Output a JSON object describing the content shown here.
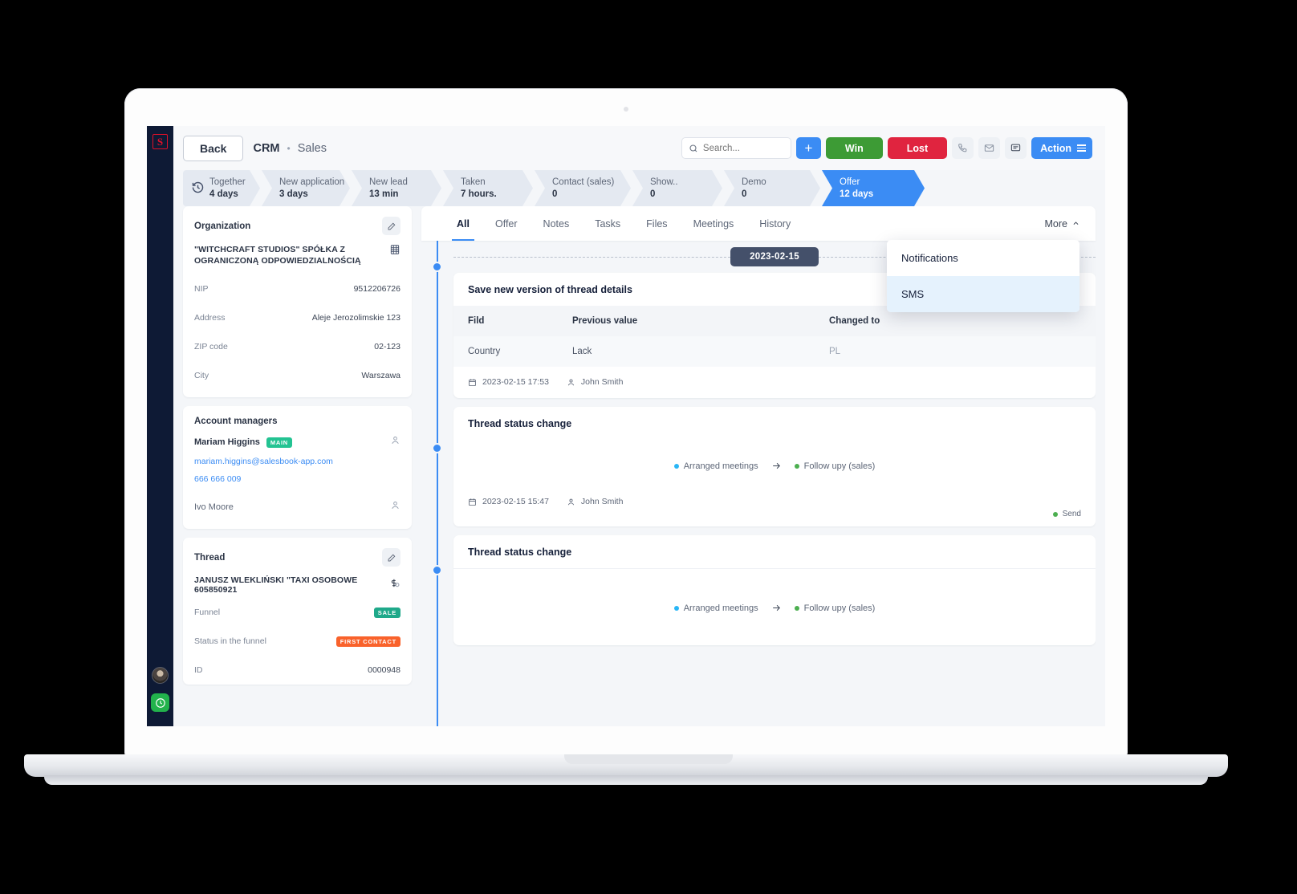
{
  "rail": {
    "logo_text": "S",
    "logo_name": "salesbook-logo",
    "avatar_name": "user-avatar",
    "clock_name": "time-tracker-icon"
  },
  "topbar": {
    "back_label": "Back",
    "breadcrumb_app": "CRM",
    "breadcrumb_sep": "•",
    "breadcrumb_section": "Sales",
    "search_placeholder": "Search...",
    "search_value": "",
    "add_label": "+",
    "win_label": "Win",
    "lost_label": "Lost",
    "action_label": "Action",
    "colors": {
      "win": "#3d9b35",
      "lost": "#e0243f",
      "primary": "#3b8cf4"
    }
  },
  "funnel": {
    "stages": [
      {
        "name": "Together",
        "value": "4 days",
        "icon": "history-icon",
        "active": false
      },
      {
        "name": "New application",
        "value": "3 days",
        "active": false
      },
      {
        "name": "New lead",
        "value": "13 min",
        "active": false
      },
      {
        "name": "Taken",
        "value": "7 hours.",
        "active": false
      },
      {
        "name": "Contact (sales)",
        "value": "0",
        "active": false
      },
      {
        "name": "Show..",
        "value": "0",
        "active": false
      },
      {
        "name": "Demo",
        "value": "0",
        "active": false
      },
      {
        "name": "Offer",
        "value": "12 days",
        "active": true
      }
    ]
  },
  "organization": {
    "card_title": "Organization",
    "name": "\"WITCHCRAFT STUDIOS\" SPÓŁKA Z OGRANICZONĄ ODPOWIEDZIALNOŚCIĄ",
    "fields": [
      {
        "label": "NIP",
        "value": "9512206726"
      },
      {
        "label": "Address",
        "value": "Aleje Jerozolimskie 123"
      },
      {
        "label": "ZIP code",
        "value": "02-123"
      },
      {
        "label": "City",
        "value": "Warszawa"
      }
    ]
  },
  "account_managers": {
    "card_title": "Account managers",
    "main": {
      "name": "Mariam Higgins",
      "badge": "MAIN",
      "email": "mariam.higgins@salesbook-app.com",
      "phone": "666 666 009"
    },
    "secondary": {
      "name": "Ivo Moore"
    }
  },
  "thread": {
    "card_title": "Thread",
    "name": "JANUSZ WLEKLIŃSKI \"TAXI OSOBOWE 605850921",
    "rows": [
      {
        "label": "Funnel",
        "badge": "SALE",
        "badge_color": "#1fa98a"
      },
      {
        "label": "Status in the funnel",
        "badge": "FIRST CONTACT",
        "badge_color": "#f9622b"
      },
      {
        "label": "ID",
        "value": "0000948"
      }
    ]
  },
  "tabs": {
    "items": [
      {
        "label": "All",
        "active": true
      },
      {
        "label": "Offer",
        "active": false
      },
      {
        "label": "Notes",
        "active": false
      },
      {
        "label": "Tasks",
        "active": false
      },
      {
        "label": "Files",
        "active": false
      },
      {
        "label": "Meetings",
        "active": false
      },
      {
        "label": "History",
        "active": false
      }
    ],
    "more_label": "More"
  },
  "dropdown": {
    "items": [
      {
        "label": "Notifications",
        "highlighted": false
      },
      {
        "label": "SMS",
        "highlighted": true
      }
    ]
  },
  "feed": {
    "date_separator": "2023-02-15",
    "entries": [
      {
        "title": "Save new version of thread details",
        "table": {
          "headers": [
            "Fild",
            "Previous value",
            "Changed to"
          ],
          "rows": [
            [
              "Country",
              "Lack",
              "PL"
            ]
          ]
        },
        "timestamp": "2023-02-15 17:53",
        "author": "John Smith"
      },
      {
        "title": "Thread status change",
        "from_status": "Arranged meetings",
        "from_color": "#29b6f6",
        "to_status": "Follow upy (sales)",
        "to_color": "#4caf50",
        "timestamp": "2023-02-15 15:47",
        "author": "John Smith",
        "send_label": "Send"
      },
      {
        "title": "Thread status change",
        "from_status": "Arranged meetings",
        "from_color": "#29b6f6",
        "to_status": "Follow upy (sales)",
        "to_color": "#4caf50"
      }
    ]
  }
}
